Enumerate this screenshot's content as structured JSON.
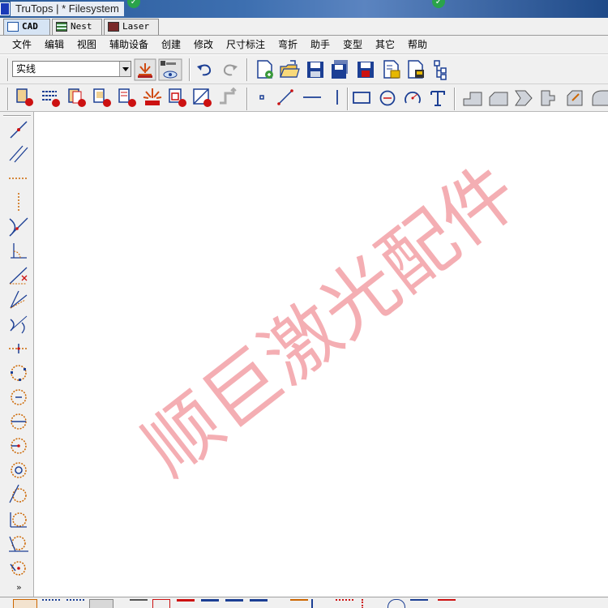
{
  "window": {
    "title": "TruTops | * Filesystem"
  },
  "tabs": [
    {
      "label": "CAD",
      "active": true
    },
    {
      "label": "Nest",
      "active": false
    },
    {
      "label": "Laser",
      "active": false
    }
  ],
  "menu": [
    "文件",
    "编辑",
    "视图",
    "辅助设备",
    "创建",
    "修改",
    "尺寸标注",
    "弯折",
    "助手",
    "变型",
    "其它",
    "帮助"
  ],
  "toolbar": {
    "linetype_value": "实线",
    "measure_badge": "222.22"
  },
  "left_toolbar": {
    "more_label": "»"
  },
  "watermark": {
    "text": "顺巨激光配件"
  },
  "colors": {
    "watermark": "#f2a0a6",
    "accent_red": "#cc1111",
    "icon_blue": "#1c3f94"
  }
}
